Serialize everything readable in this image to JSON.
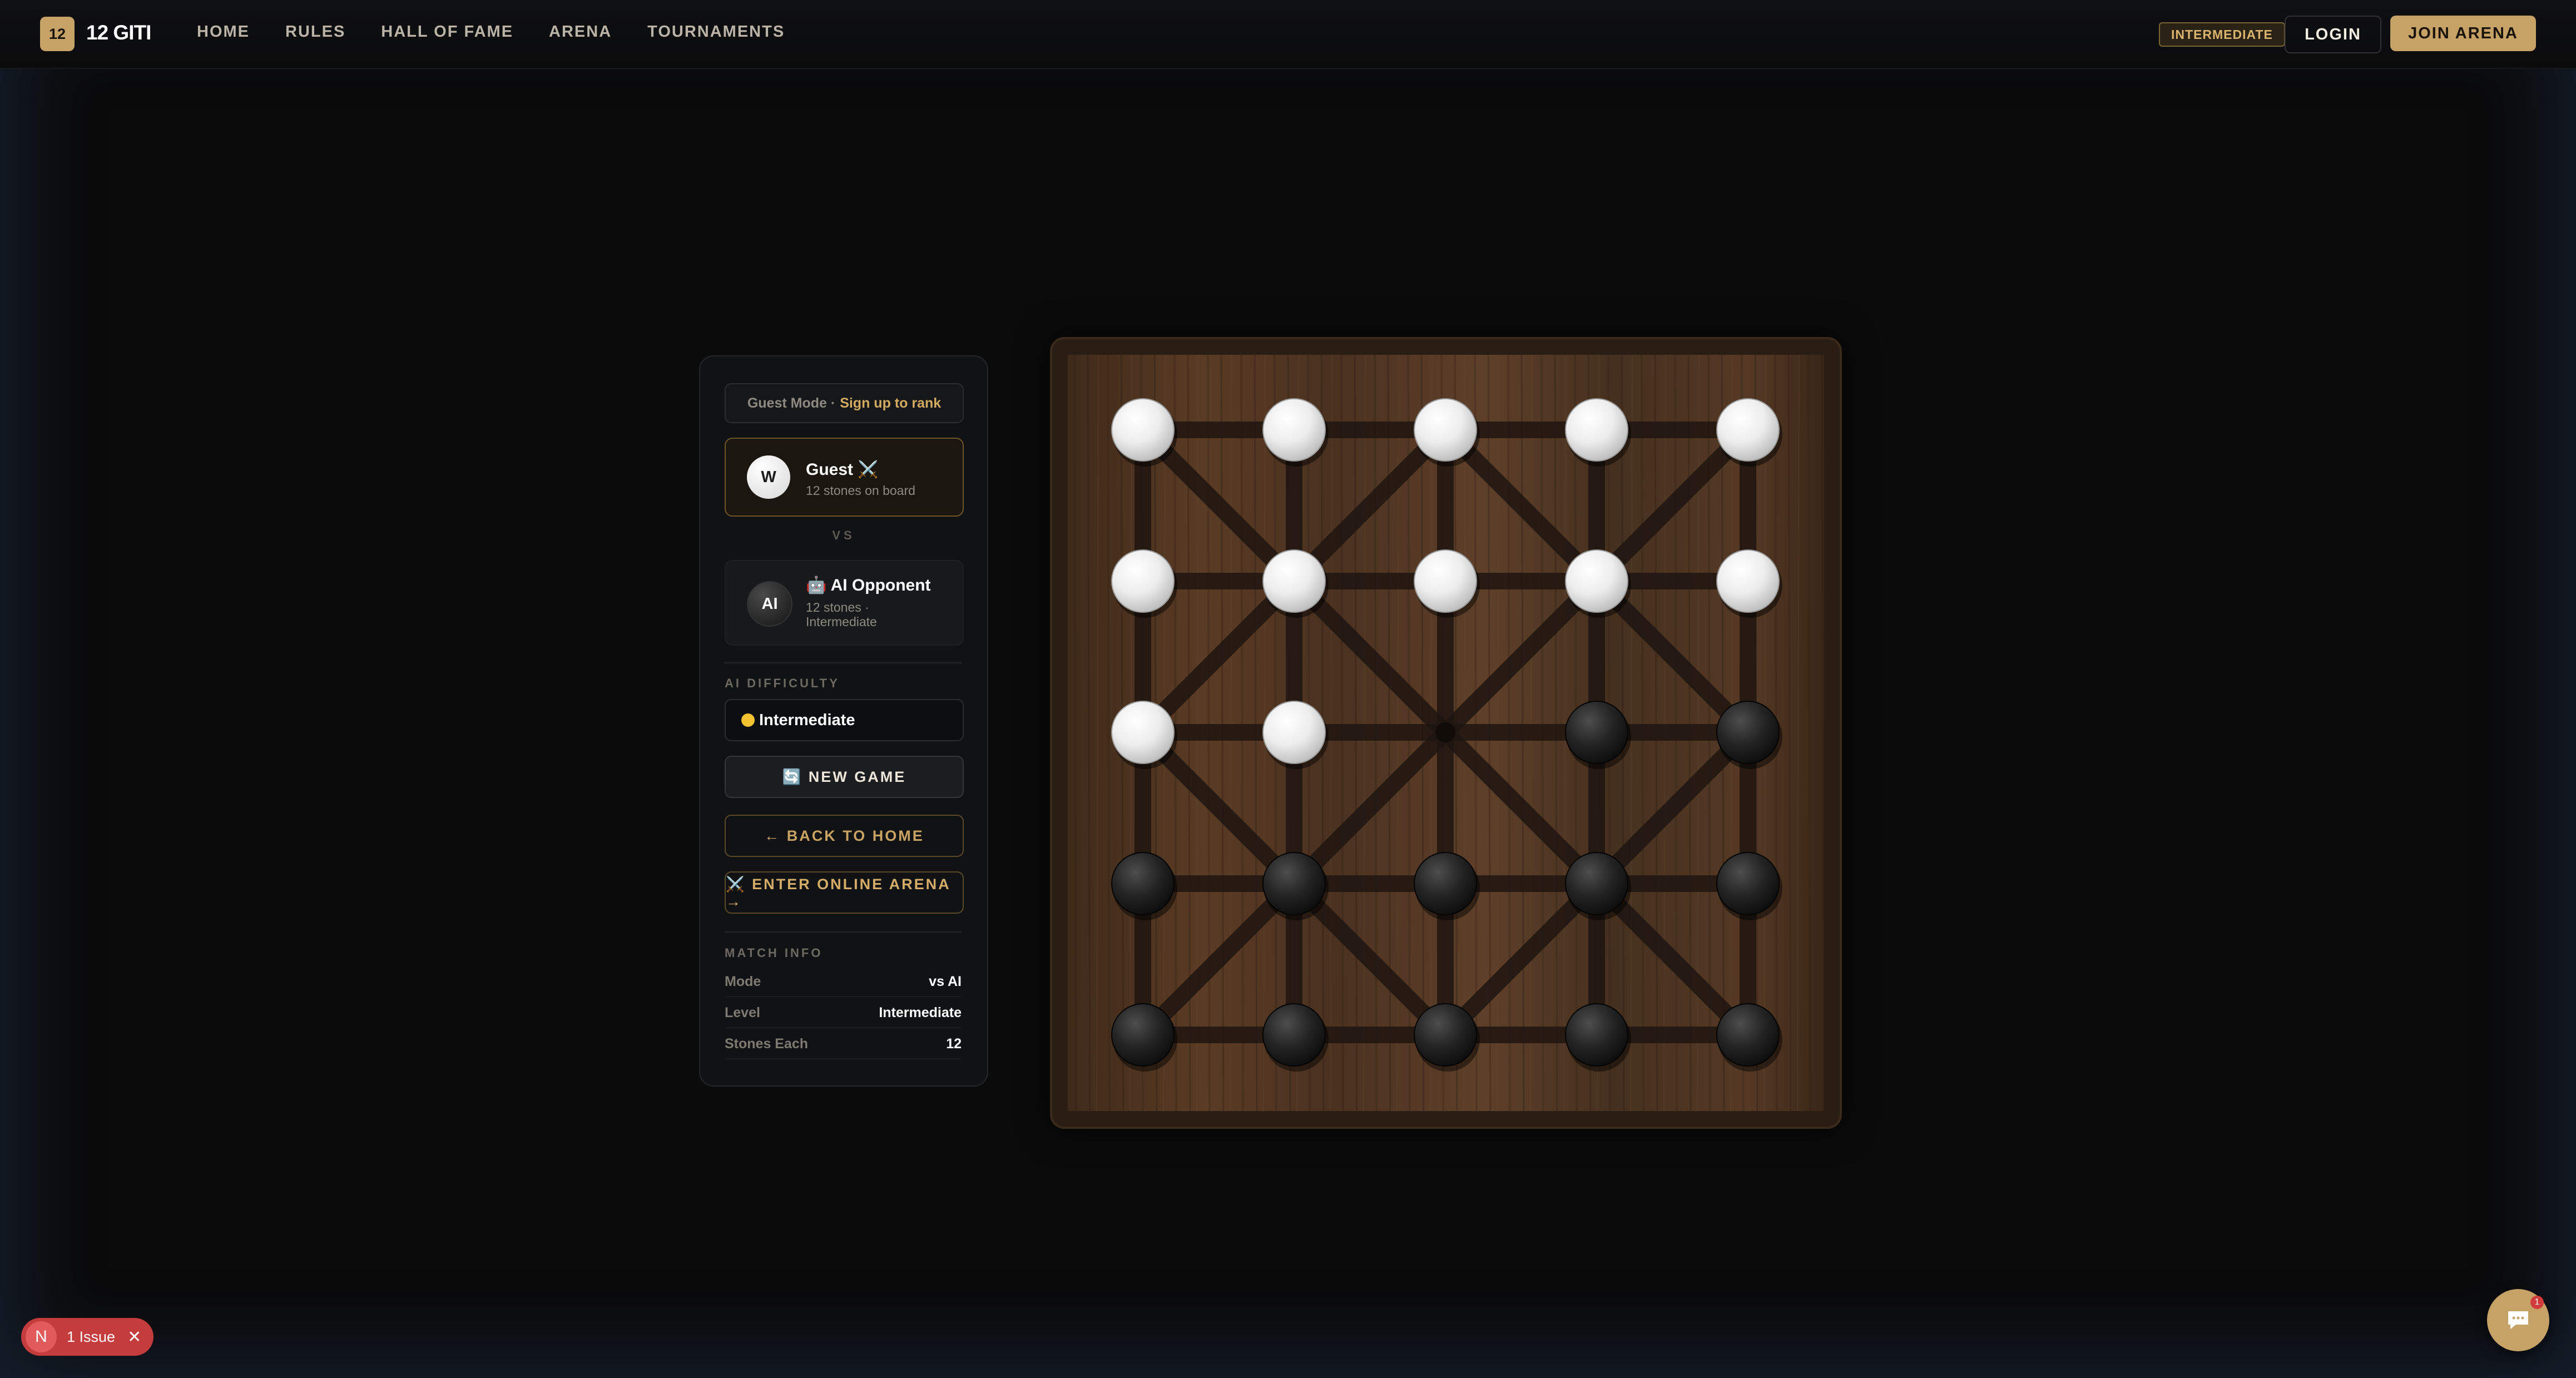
{
  "header": {
    "logo_badge": "12",
    "logo_text": "12 GITI",
    "nav": [
      "HOME",
      "RULES",
      "HALL OF FAME",
      "ARENA",
      "TOURNAMENTS"
    ],
    "difficulty_badge": "INTERMEDIATE",
    "login_label": "LOGIN",
    "join_label": "JOIN ARENA"
  },
  "panel": {
    "guest_mode_text": "Guest Mode ·",
    "guest_mode_link": "Sign up to rank",
    "player": {
      "avatar": "W",
      "name": "Guest ⚔️",
      "sub": "12 stones on board"
    },
    "vs": "VS",
    "opponent": {
      "avatar": "AI",
      "name": "🤖 AI Opponent",
      "sub_line1": "12 stones ·",
      "sub_line2": "Intermediate"
    },
    "ai_difficulty_label": "AI DIFFICULTY",
    "difficulty_selected": "Intermediate",
    "new_game_label": "🔄 NEW GAME",
    "back_home_label": "← BACK TO HOME",
    "enter_arena_label": "⚔️ ENTER ONLINE ARENA →",
    "match_info_label": "MATCH INFO",
    "match_info": [
      {
        "key": "Mode",
        "value": "vs AI"
      },
      {
        "key": "Level",
        "value": "Intermediate"
      },
      {
        "key": "Stones Each",
        "value": "12"
      }
    ]
  },
  "board": {
    "stones": [
      [
        "W",
        "W",
        "W",
        "W",
        "W"
      ],
      [
        "W",
        "W",
        "W",
        "W",
        "W"
      ],
      [
        "W",
        "W",
        "",
        "B",
        "B"
      ],
      [
        "B",
        "B",
        "B",
        "B",
        "B"
      ],
      [
        "B",
        "B",
        "B",
        "B",
        "B"
      ]
    ]
  },
  "issues": {
    "badge": "N",
    "label": "1 Issue"
  },
  "chat": {
    "count": "1"
  },
  "colors": {
    "accent": "#c6a266",
    "background": "#0b0b0c",
    "issue_red": "#c53c3c"
  }
}
